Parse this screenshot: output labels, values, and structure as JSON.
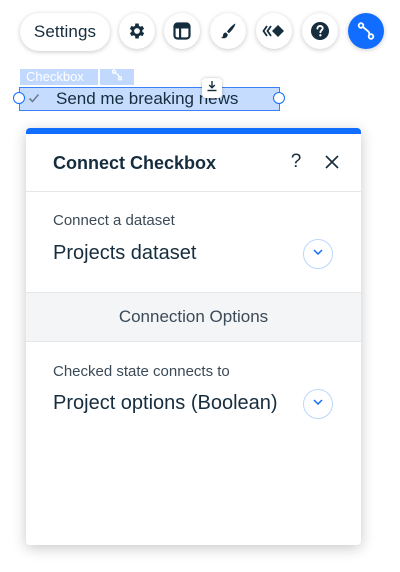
{
  "toolbar": {
    "settings_label": "Settings",
    "buttons": [
      {
        "name": "gear-icon"
      },
      {
        "name": "layout-icon"
      },
      {
        "name": "brush-icon"
      },
      {
        "name": "animation-icon"
      },
      {
        "name": "help-icon"
      },
      {
        "name": "connect-data-icon",
        "active": true
      }
    ],
    "accent_color": "#116dff"
  },
  "selected_element": {
    "tag_label": "Checkbox",
    "checkbox_label": "Send me breaking news",
    "checked": true
  },
  "panel": {
    "title": "Connect Checkbox",
    "help_label": "?",
    "dataset": {
      "label": "Connect a dataset",
      "value": "Projects dataset"
    },
    "options_title": "Connection Options",
    "checked_state": {
      "label": "Checked state connects to",
      "value": "Project options (Boolean)"
    }
  }
}
